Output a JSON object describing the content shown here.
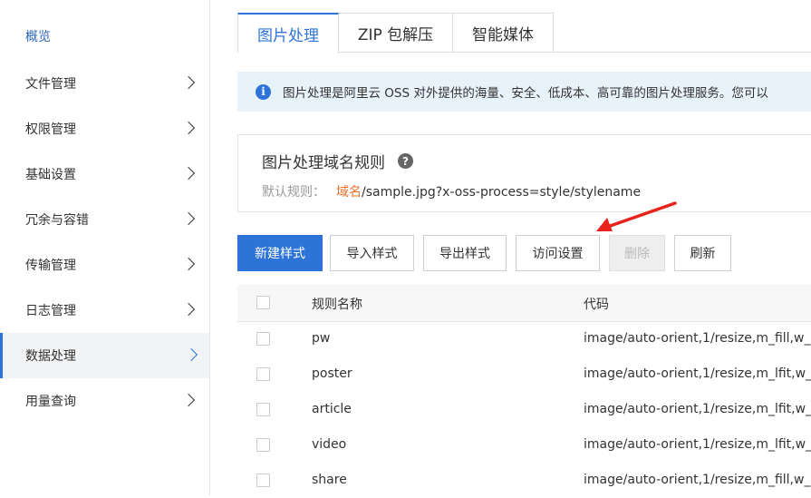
{
  "sidebar": {
    "items": [
      {
        "label": "概览",
        "has_chevron": false
      },
      {
        "label": "文件管理",
        "has_chevron": true
      },
      {
        "label": "权限管理",
        "has_chevron": true
      },
      {
        "label": "基础设置",
        "has_chevron": true
      },
      {
        "label": "冗余与容错",
        "has_chevron": true
      },
      {
        "label": "传输管理",
        "has_chevron": true
      },
      {
        "label": "日志管理",
        "has_chevron": true
      },
      {
        "label": "数据处理",
        "has_chevron": true,
        "active": true
      },
      {
        "label": "用量查询",
        "has_chevron": true
      }
    ]
  },
  "tabs": [
    {
      "label": "图片处理",
      "active": true
    },
    {
      "label": "ZIP 包解压"
    },
    {
      "label": "智能媒体"
    }
  ],
  "info": {
    "icon": "info-icon",
    "text": "图片处理是阿里云 OSS 对外提供的海量、安全、低成本、高可靠的图片处理服务。您可以"
  },
  "rule": {
    "title": "图片处理域名规则",
    "help_icon": "question-icon",
    "label": "默认规则：",
    "domain": "域名",
    "path": "/sample.jpg?x-oss-process=style/stylename"
  },
  "toolbar": {
    "new_style": "新建样式",
    "import_style": "导入样式",
    "export_style": "导出样式",
    "access_settings": "访问设置",
    "delete": "删除",
    "refresh": "刷新"
  },
  "table": {
    "columns": [
      "规则名称",
      "代码"
    ],
    "rows": [
      {
        "name": "pw",
        "code": "image/auto-orient,1/resize,m_fill,w_"
      },
      {
        "name": "poster",
        "code": "image/auto-orient,1/resize,m_lfit,w_"
      },
      {
        "name": "article",
        "code": "image/auto-orient,1/resize,m_lfit,w_"
      },
      {
        "name": "video",
        "code": "image/auto-orient,1/resize,m_lfit,w_"
      },
      {
        "name": "share",
        "code": "image/auto-orient,1/resize,m_fill,w_"
      }
    ]
  },
  "colors": {
    "accent": "#2e74d8",
    "info_bg": "#e8f2fb",
    "domain_orange": "#e8702a",
    "arrow_red": "#e8231b"
  }
}
